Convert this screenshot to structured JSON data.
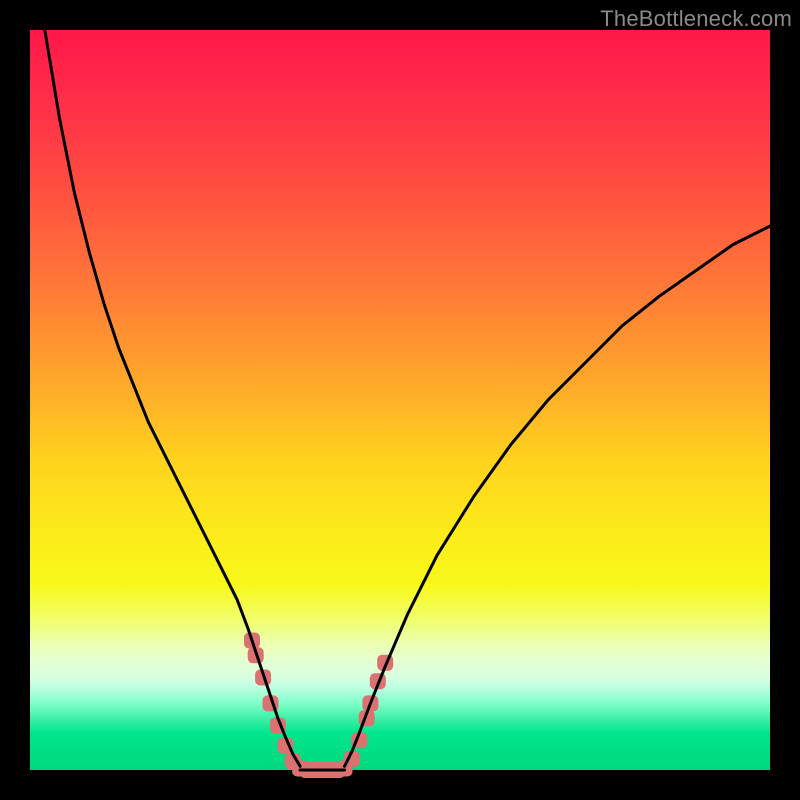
{
  "watermark": "TheBottleneck.com",
  "chart_data": {
    "type": "line",
    "title": "",
    "xlabel": "",
    "ylabel": "",
    "xlim": [
      0,
      100
    ],
    "ylim": [
      0,
      100
    ],
    "grid": false,
    "legend": null,
    "series": [
      {
        "name": "left-curve",
        "x": [
          2,
          4,
          6,
          8,
          10,
          12,
          14,
          16,
          18,
          20,
          22,
          24,
          26,
          28,
          29.5,
          30.5,
          31.5,
          32.5,
          33.5,
          34.5,
          35.5,
          36.5
        ],
        "values": [
          100,
          88,
          78,
          70,
          63,
          57,
          52,
          47,
          43,
          39,
          35,
          31,
          27,
          23,
          19,
          16,
          13,
          10,
          7,
          4.5,
          2.2,
          0.5
        ]
      },
      {
        "name": "right-curve",
        "x": [
          42.5,
          43.5,
          44.5,
          46,
          48,
          51,
          55,
          60,
          65,
          70,
          75,
          80,
          85,
          90,
          95,
          100
        ],
        "values": [
          0.5,
          2.5,
          5,
          9,
          14,
          21,
          29,
          37,
          44,
          50,
          55,
          60,
          64,
          67.5,
          71,
          73.5
        ]
      }
    ],
    "annotations": {
      "flat_bottom_x_range": [
        36.5,
        42.5
      ],
      "markers": [
        {
          "x": 30.0,
          "y": 17.5
        },
        {
          "x": 30.5,
          "y": 15.5
        },
        {
          "x": 31.5,
          "y": 12.5
        },
        {
          "x": 32.5,
          "y": 9.0
        },
        {
          "x": 33.5,
          "y": 6.0
        },
        {
          "x": 34.5,
          "y": 3.3
        },
        {
          "x": 35.5,
          "y": 1.2
        },
        {
          "x": 36.5,
          "y": 0.2
        },
        {
          "x": 37.5,
          "y": 0.0
        },
        {
          "x": 38.5,
          "y": 0.0
        },
        {
          "x": 39.5,
          "y": 0.0
        },
        {
          "x": 40.5,
          "y": 0.0
        },
        {
          "x": 41.5,
          "y": 0.0
        },
        {
          "x": 42.5,
          "y": 0.2
        },
        {
          "x": 43.5,
          "y": 1.5
        },
        {
          "x": 44.5,
          "y": 4.0
        },
        {
          "x": 45.5,
          "y": 7.0
        },
        {
          "x": 46.0,
          "y": 9.0
        },
        {
          "x": 47.0,
          "y": 12.0
        },
        {
          "x": 48.0,
          "y": 14.5
        }
      ]
    },
    "colors": {
      "curve": "#000000",
      "markers": "#db7171",
      "gradient_top": "#ff1848",
      "gradient_bottom": "#00d87e"
    }
  }
}
